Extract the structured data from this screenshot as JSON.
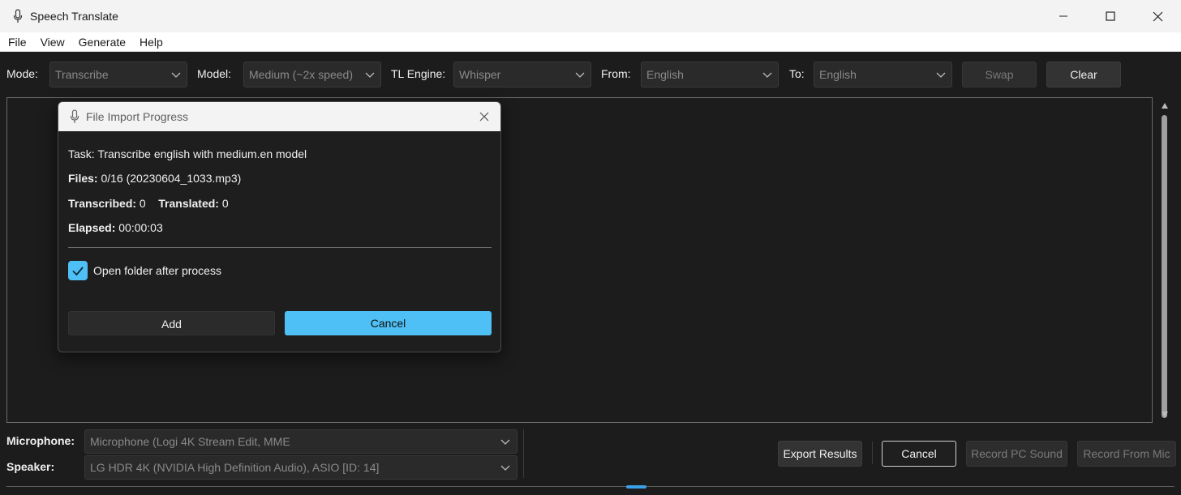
{
  "window": {
    "title": "Speech Translate"
  },
  "menu": [
    "File",
    "View",
    "Generate",
    "Help"
  ],
  "toolbar": {
    "mode_label": "Mode:",
    "mode_value": "Transcribe",
    "model_label": "Model:",
    "model_value": "Medium (~2x speed)",
    "engine_label": "TL Engine:",
    "engine_value": "Whisper",
    "from_label": "From:",
    "from_value": "English",
    "to_label": "To:",
    "to_value": "English",
    "swap_label": "Swap",
    "clear_label": "Clear"
  },
  "dialog": {
    "title": "File Import Progress",
    "task_line": "Task: Transcribe english with medium.en model",
    "files_label": "Files:",
    "files_value": "0/16 (20230604_1033.mp3)",
    "transcribed_label": "Transcribed:",
    "transcribed_value": "0",
    "translated_label": "Translated:",
    "translated_value": "0",
    "elapsed_label": "Elapsed:",
    "elapsed_value": "00:00:03",
    "open_folder_label": "Open folder after process",
    "open_folder_checked": true,
    "add_label": "Add",
    "cancel_label": "Cancel"
  },
  "bottom": {
    "mic_label": "Microphone:",
    "mic_value": "Microphone (Logi 4K Stream Edit, MME",
    "speaker_label": "Speaker:",
    "speaker_value": "LG HDR 4K (NVIDIA High Definition Audio), ASIO [ID: 14]",
    "export_label": "Export Results",
    "cancel_label": "Cancel",
    "record_pc_label": "Record PC Sound",
    "record_mic_label": "Record From Mic"
  },
  "colors": {
    "accent": "#4fc0f5",
    "background": "#1c1c1c",
    "titlebar": "#f3f3f3"
  }
}
